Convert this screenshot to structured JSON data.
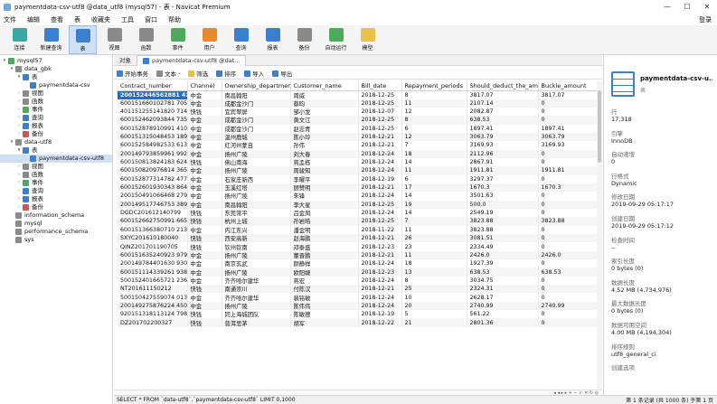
{
  "window": {
    "title": "paymentdata-csv-utf8 @data_utf8 (mysql57) - 表 - Navicat Premium",
    "minimize": "—",
    "maximize": "☐",
    "close": "✕"
  },
  "menu": {
    "items": [
      "文件",
      "编辑",
      "查看",
      "表",
      "收藏夹",
      "工具",
      "窗口",
      "帮助"
    ],
    "user": "登录"
  },
  "toolbar": {
    "items": [
      {
        "label": "连接",
        "icon": "plug-icon",
        "color": "c-teal"
      },
      {
        "label": "新建查询",
        "icon": "new-query-icon",
        "color": "c-blue"
      },
      {
        "label": "表",
        "icon": "table-icon",
        "color": "c-blue"
      },
      {
        "label": "视图",
        "icon": "view-icon",
        "color": "c-gray"
      },
      {
        "label": "函数",
        "icon": "function-icon",
        "color": "c-gray"
      },
      {
        "label": "事件",
        "icon": "clock-icon",
        "color": "c-green"
      },
      {
        "label": "用户",
        "icon": "user-icon",
        "color": "c-orange"
      },
      {
        "label": "查询",
        "icon": "query-icon",
        "color": "c-blue"
      },
      {
        "label": "报表",
        "icon": "report-icon",
        "color": "c-blue"
      },
      {
        "label": "备份",
        "icon": "backup-icon",
        "color": "c-gray"
      },
      {
        "label": "自动运行",
        "icon": "auto-run-icon",
        "color": "c-green"
      },
      {
        "label": "模型",
        "icon": "model-icon",
        "color": "c-yellow"
      }
    ]
  },
  "tree": {
    "nodes": [
      {
        "label": "mysql57",
        "level": 0,
        "arrow": "▾",
        "color": "c-green"
      },
      {
        "label": "data_gbk",
        "level": 1,
        "arrow": "▾",
        "color": "c-gray"
      },
      {
        "label": "表",
        "level": 2,
        "arrow": "▾",
        "color": "c-blue"
      },
      {
        "label": "paymentdata-csv",
        "level": 3,
        "arrow": "",
        "color": "c-blue"
      },
      {
        "label": "视图",
        "level": 2,
        "arrow": "›",
        "color": "c-gray"
      },
      {
        "label": "函数",
        "level": 2,
        "arrow": "›",
        "color": "c-gray"
      },
      {
        "label": "事件",
        "level": 2,
        "arrow": "›",
        "color": "c-green"
      },
      {
        "label": "查询",
        "level": 2,
        "arrow": "›",
        "color": "c-blue"
      },
      {
        "label": "报表",
        "level": 2,
        "arrow": "›",
        "color": "c-blue"
      },
      {
        "label": "备份",
        "level": 2,
        "arrow": "›",
        "color": "c-red"
      },
      {
        "label": "data-utf8",
        "level": 1,
        "arrow": "▾",
        "color": "c-gray"
      },
      {
        "label": "表",
        "level": 2,
        "arrow": "▾",
        "color": "c-blue"
      },
      {
        "label": "paymentdata-csv-utf8",
        "level": 3,
        "arrow": "",
        "color": "c-blue",
        "selected": true
      },
      {
        "label": "视图",
        "level": 2,
        "arrow": "›",
        "color": "c-gray"
      },
      {
        "label": "函数",
        "level": 2,
        "arrow": "›",
        "color": "c-gray"
      },
      {
        "label": "事件",
        "level": 2,
        "arrow": "›",
        "color": "c-green"
      },
      {
        "label": "查询",
        "level": 2,
        "arrow": "›",
        "color": "c-blue"
      },
      {
        "label": "报表",
        "level": 2,
        "arrow": "›",
        "color": "c-blue"
      },
      {
        "label": "备份",
        "level": 2,
        "arrow": "›",
        "color": "c-red"
      },
      {
        "label": "information_schema",
        "level": 1,
        "arrow": "",
        "color": "c-gray"
      },
      {
        "label": "mysql",
        "level": 1,
        "arrow": "",
        "color": "c-gray"
      },
      {
        "label": "performance_schema",
        "level": 1,
        "arrow": "",
        "color": "c-gray"
      },
      {
        "label": "sys",
        "level": 1,
        "arrow": "",
        "color": "c-gray"
      }
    ]
  },
  "tabs": {
    "objects": "对象",
    "active": "paymentdata-csv-utf8 @dat..."
  },
  "subtoolbar": {
    "items": [
      {
        "label": "开始事务",
        "color": "c-blue"
      },
      {
        "label": "文本 ·",
        "color": "c-gray"
      },
      {
        "label": "筛选",
        "color": "c-yellow"
      },
      {
        "label": "排序",
        "color": "c-blue"
      },
      {
        "label": "导入",
        "color": "c-blue"
      },
      {
        "label": "导出",
        "color": "c-blue"
      }
    ]
  },
  "grid": {
    "columns": [
      "Contract_number",
      "Channel",
      "Ownership_department",
      "Customer_name",
      "Bill_date",
      "Repayment_periods",
      "Should_deduct_the_amou",
      "Buckle_amount"
    ],
    "rows": [
      [
        "200152446562881 4205",
        "中金",
        "南昌翰阳",
        "周威",
        "2018-12-25",
        "8",
        "3817.07",
        "3817.07"
      ],
      [
        "600151660102781 7058",
        "中金",
        "成都金沙门",
        "蔡昀",
        "2018-12-25",
        "11",
        "2107.14",
        "0"
      ],
      [
        "401151255141820 7149",
        "快钱",
        "宜宾翠屏",
        "邹小龙",
        "2018-12-07",
        "12",
        "2082.87",
        "0"
      ],
      [
        "600152462093844 7358",
        "中金",
        "成都金沙门",
        "黄文江",
        "2018-12-25",
        "8",
        "638.53",
        "0"
      ],
      [
        "600152878910991 4105",
        "中金",
        "成都金沙门",
        "赵忠青",
        "2018-12-25",
        "6",
        "1897.41",
        "1897.41"
      ],
      [
        "600151315048453 1892",
        "中金",
        "温州鹿城",
        "陈小玲",
        "2018-12-21",
        "12",
        "3063.79",
        "3063.79"
      ],
      [
        "600152584982533 61330",
        "中金",
        "红河州蒙自",
        "孙伟",
        "2018-12-21",
        "7",
        "3169.93",
        "3169.93"
      ],
      [
        "200149793859961 99255",
        "中金",
        "扬州广陵",
        "刘大春",
        "2018-12-24",
        "18",
        "2112.96",
        "0"
      ],
      [
        "600150813824183 6240",
        "快钱",
        "佛山南海",
        "蒋孟栋",
        "2018-12-24",
        "14",
        "2867.91",
        "0"
      ],
      [
        "600150820976814 36528",
        "中金",
        "扬州广陵",
        "周骏知",
        "2018-12-24",
        "11",
        "1911.81",
        "1911.81"
      ],
      [
        "600152877314782 47742",
        "中金",
        "石家庄新西",
        "李曜平",
        "2018-12-19",
        "6",
        "3297.37",
        "0"
      ],
      [
        "600152601930343 86431",
        "中金",
        "玉溪红塔",
        "顾赞明",
        "2018-12-21",
        "17",
        "1670.3",
        "1670.3"
      ],
      [
        "200150491066468 27902",
        "中金",
        "扬州广陵",
        "朱锋",
        "2018-12-24",
        "14",
        "3501.63",
        "0"
      ],
      [
        "200149517746753 38912",
        "中金",
        "南昌翰阳",
        "李大星",
        "2018-12-25",
        "19",
        "500.0",
        "0"
      ],
      [
        "DGDC201612140799",
        "快钱",
        "东莞常平",
        "吕金凤",
        "2018-12-24",
        "14",
        "2549.19",
        "0"
      ],
      [
        "600152662750991 66579",
        "快钱",
        "杭州上城",
        "孙岩皓",
        "2018-12-25",
        "7",
        "3823.88",
        "3823.88"
      ],
      [
        "600151366380710 21366",
        "中金",
        "内江东兴",
        "潘金明",
        "2018-11-22",
        "11",
        "3823.88",
        "0"
      ],
      [
        "SXYC201610180040",
        "快钱",
        "西安高新",
        "赵海鹏",
        "2018-12-21",
        "26",
        "3081.51",
        "0"
      ],
      [
        "QINZ201701190705",
        "快钱",
        "钦州钦南",
        "邓泰盛",
        "2018-12-23",
        "23",
        "2334.49",
        "0"
      ],
      [
        "600151635240923 97903",
        "中金",
        "扬州广陵",
        "董晋鹏",
        "2018-12-21",
        "11",
        "2426.0",
        "2426.0"
      ],
      [
        "200149784401630 93077",
        "中金",
        "南京玄武",
        "颜静样",
        "2018-12-24",
        "18",
        "1927.39",
        "0"
      ],
      [
        "600151114339261 93879",
        "中金",
        "扬州广陵",
        "欧阳婕",
        "2018-12-23",
        "13",
        "638.53",
        "638.53"
      ],
      [
        "500152401665721 23611",
        "中金",
        "齐齐哈尔建华",
        "蒋宏",
        "2018-12-24",
        "8",
        "3034.75",
        "0"
      ],
      [
        "NT201611150212",
        "快钱",
        "南通崇川",
        "付陈汉",
        "2018-12-21",
        "25",
        "2324.31",
        "0"
      ],
      [
        "500150427559074 013",
        "中金",
        "齐齐哈尔建华",
        "裴铭敏",
        "2018-12-24",
        "10",
        "2628.17",
        "0"
      ],
      [
        "200149275876224 4505",
        "中金",
        "扬州广陵",
        "陈伟伟",
        "2018-12-24",
        "20",
        "2740.99",
        "2740.99"
      ],
      [
        "920151318113124 79804",
        "快钱",
        "同上海城团队",
        "陈敏德",
        "2018-12-19",
        "5",
        "561.22",
        "0"
      ],
      [
        "DZ201702200327",
        "快钱",
        "普洱思茅",
        "胡军",
        "2018-12-22",
        "21",
        "2801.36",
        "0"
      ]
    ],
    "footer": "◂  ◂  ▸  ▸  +  −  ✓  ✕  ↻  ◎"
  },
  "statusbar": {
    "sql": "SELECT * FROM `data-utf8`.`paymentdata-csv-utf8` LIMIT 0,1000",
    "right": "第 1 条记录 (共 1000 条) 于第 1 页"
  },
  "info": {
    "name": "paymentdata-csv-u...",
    "type": "表",
    "props": [
      {
        "label": "行",
        "value": "17,318"
      },
      {
        "label": "引擎",
        "value": "InnoDB"
      },
      {
        "label": "自动递增",
        "value": "0"
      },
      {
        "label": "行格式",
        "value": "Dynamic"
      },
      {
        "label": "修改日期",
        "value": "2019-09-29 05:17:17"
      },
      {
        "label": "创建日期",
        "value": "2019-09-29 05:17:12"
      },
      {
        "label": "检查时间",
        "value": "--"
      },
      {
        "label": "索引长度",
        "value": "0 bytes (0)"
      },
      {
        "label": "数据长度",
        "value": "4.52 MB (4,734,976)"
      },
      {
        "label": "最大数据长度",
        "value": "0 bytes (0)"
      },
      {
        "label": "数据可用空间",
        "value": "4.00 MB (4,194,304)"
      },
      {
        "label": "排序规则",
        "value": "utf8_general_ci"
      },
      {
        "label": "创建选项",
        "value": ""
      }
    ]
  }
}
